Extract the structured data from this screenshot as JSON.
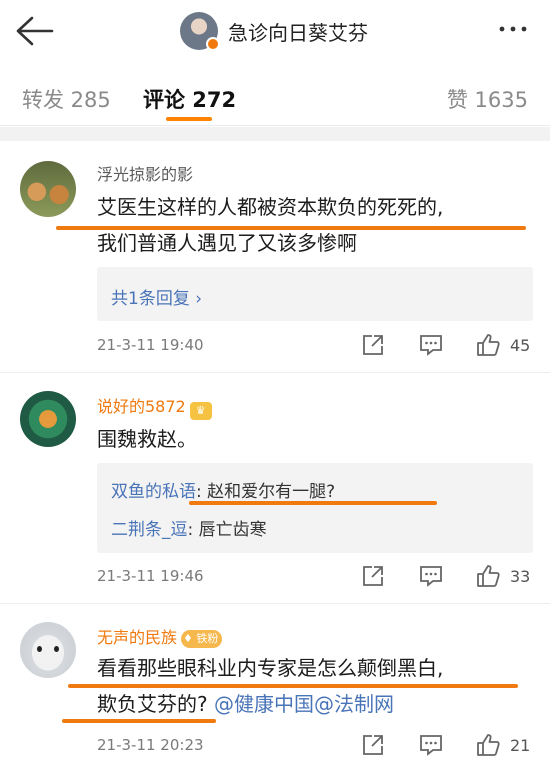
{
  "header": {
    "title": "急诊向日葵艾芬"
  },
  "tabs": {
    "repost": "转发 285",
    "comments": "评论 272",
    "likes": "赞 1635"
  },
  "comments": [
    {
      "user": "浮光掠影的影",
      "text_line1": "艾医生这样的人都被资本欺负的死死的,",
      "text_line2": "我们普通人遇见了又该多惨啊",
      "replies_link": "共1条回复 ›",
      "time": "21-3-11 19:40",
      "likes": "45"
    },
    {
      "user": "说好的5872",
      "text_line1": "围魏救赵。",
      "replies": [
        {
          "user": "双鱼的私语",
          "text": ": 赵和爱尔有一腿?"
        },
        {
          "user": "二荆条_逗",
          "text": ": 唇亡齿寒"
        }
      ],
      "time": "21-3-11 19:46",
      "likes": "33"
    },
    {
      "user": "无声的民族",
      "fan_badge": "铁粉",
      "text_line1": "看看那些眼科业内专家是怎么颠倒黑白,",
      "text_line2_plain": "欺负艾芬的?",
      "text_line2_mention": " @健康中国@法制网",
      "time": "21-3-11 20:23",
      "likes": "21"
    }
  ],
  "colors": {
    "accent": "#ff8200",
    "link": "#4a74b8",
    "highlight": "#f07a10"
  },
  "icons": [
    "back-arrow-icon",
    "more-dots-icon",
    "share-icon",
    "comment-icon",
    "like-icon",
    "chevron-right-icon"
  ]
}
